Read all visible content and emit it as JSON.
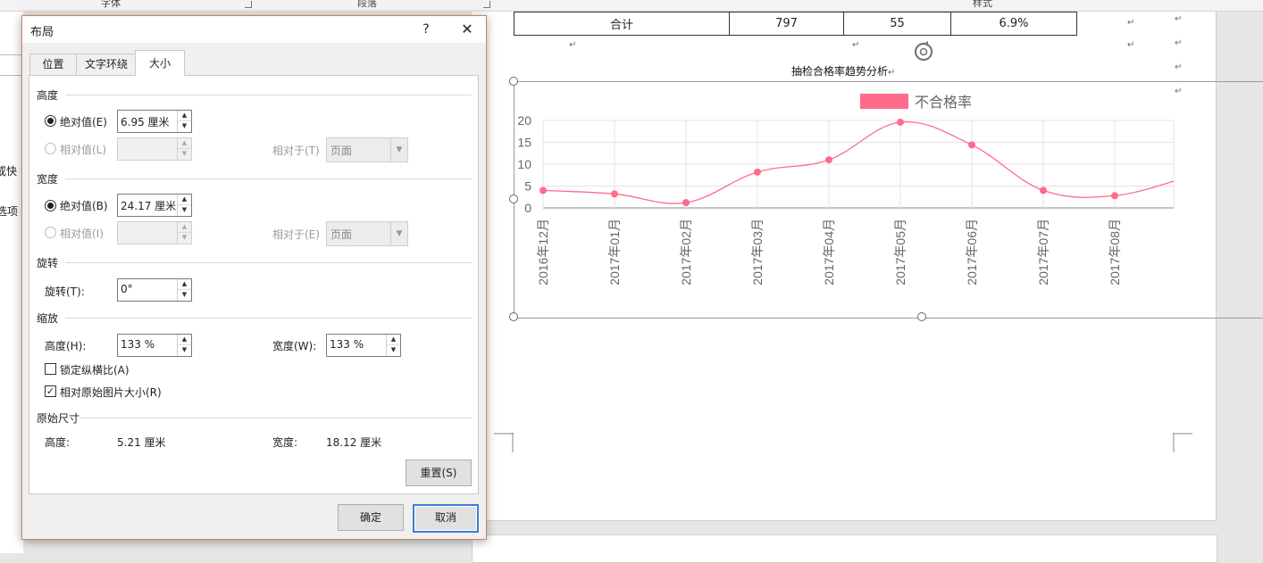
{
  "ribbon": {
    "groups": [
      "字体",
      "段落",
      "样式"
    ]
  },
  "left_pane": {
    "snippets": [
      "或快",
      "选项"
    ]
  },
  "document": {
    "table_row": [
      "合计",
      "797",
      "55",
      "6.9%"
    ],
    "pilcrow": "↵",
    "chart_caption": "抽检合格率趋势分析"
  },
  "dialog": {
    "title": "布局",
    "help": "?",
    "close": "✕",
    "tabs": [
      "位置",
      "文字环绕",
      "大小"
    ],
    "active_tab": "大小",
    "height_section": {
      "label": "高度",
      "absolute_label": "绝对值(E)",
      "absolute_value": "6.95 厘米",
      "relative_label": "相对值(L)",
      "relative_value": "",
      "relative_to_label": "相对于(T)",
      "relative_to_value": "页面"
    },
    "width_section": {
      "label": "宽度",
      "absolute_label": "绝对值(B)",
      "absolute_value": "24.17 厘米",
      "relative_label": "相对值(I)",
      "relative_value": "",
      "relative_to_label": "相对于(E)",
      "relative_to_value": "页面"
    },
    "rotation_section": {
      "label": "旋转",
      "field_label": "旋转(T):",
      "value": "0°"
    },
    "scale_section": {
      "label": "缩放",
      "height_label": "高度(H):",
      "height_value": "133 %",
      "width_label": "宽度(W):",
      "width_value": "133 %",
      "lock_aspect_label": "锁定纵横比(A)",
      "lock_aspect_checked": false,
      "relative_original_label": "相对原始图片大小(R)",
      "relative_original_checked": true
    },
    "original_section": {
      "label": "原始尺寸",
      "height_label": "高度:",
      "height_value": "5.21 厘米",
      "width_label": "宽度:",
      "width_value": "18.12 厘米"
    },
    "reset_label": "重置(S)",
    "ok_label": "确定",
    "cancel_label": "取消"
  },
  "colors": {
    "series": "#ff6b8a",
    "dialog_border": "#c9855a",
    "default_button": "#3b7fd1"
  },
  "chart_data": {
    "type": "line",
    "title": "",
    "legend": [
      "不合格率"
    ],
    "legend_placement": "top-center",
    "categories": [
      "2016年12月",
      "2017年01月",
      "2017年02月",
      "2017年03月",
      "2017年04月",
      "2017年05月",
      "2017年06月",
      "2017年07月",
      "2017年08月"
    ],
    "series": [
      {
        "name": "不合格率",
        "values": [
          4,
          3.2,
          1.2,
          8.2,
          11,
          19.6,
          14.4,
          4,
          2.8
        ]
      }
    ],
    "next_value_partial": 7,
    "yticks": [
      0,
      5,
      10,
      15,
      20
    ],
    "ylim": [
      0,
      20
    ],
    "smooth": true,
    "grid": true
  }
}
